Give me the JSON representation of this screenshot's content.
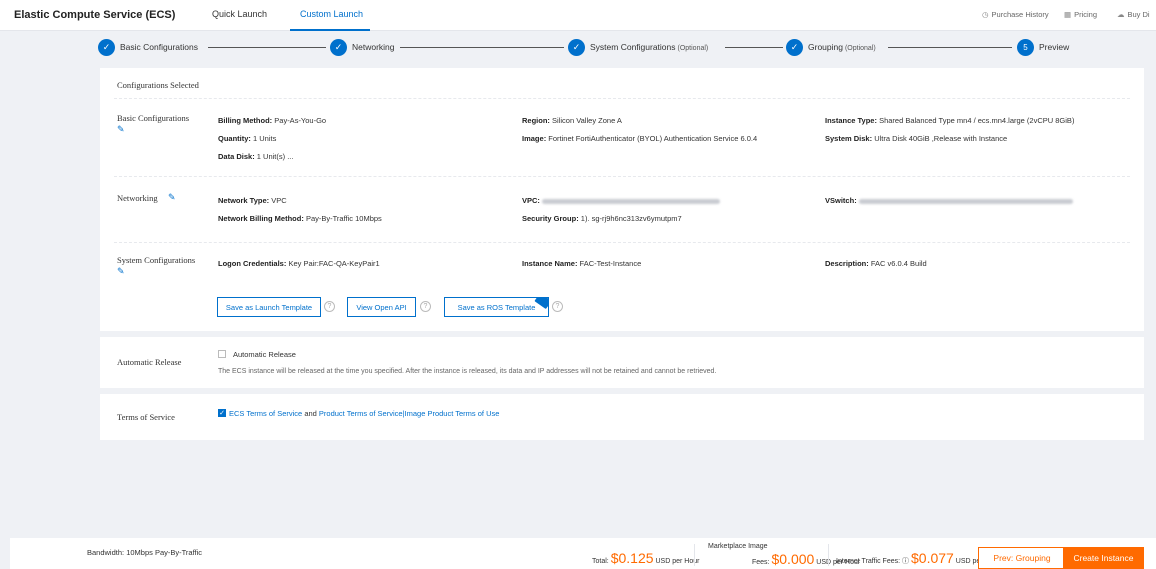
{
  "header": {
    "app_title": "Elastic Compute Service (ECS)",
    "tabs": [
      {
        "label": "Quick Launch",
        "active": false
      },
      {
        "label": "Custom Launch",
        "active": true
      }
    ],
    "links": [
      {
        "label": "Purchase History",
        "icon": "clock-icon"
      },
      {
        "label": "Pricing",
        "icon": "table-icon"
      },
      {
        "label": "Buy Di",
        "icon": "cloud-icon"
      }
    ]
  },
  "steps": [
    {
      "label": "Basic Configurations",
      "optional": "",
      "done": true
    },
    {
      "label": "Networking",
      "optional": "",
      "done": true
    },
    {
      "label": "System Configurations",
      "optional": "(Optional)",
      "done": true
    },
    {
      "label": "Grouping",
      "optional": "(Optional)",
      "done": true
    },
    {
      "label": "Preview",
      "optional": "",
      "number": "5",
      "done": false
    }
  ],
  "selected": {
    "title": "Configurations Selected",
    "basic": {
      "title": "Basic Configurations",
      "billing": {
        "key": "Billing Method",
        "value": "Pay-As-You-Go"
      },
      "quantity": {
        "key": "Quantity",
        "value": "1 Units"
      },
      "data_disk": {
        "key": "Data Disk",
        "value": "1 Unit(s) ..."
      },
      "region": {
        "key": "Region",
        "value": "Silicon Valley Zone A"
      },
      "image": {
        "key": "Image",
        "value": "Fortinet FortiAuthenticator (BYOL) Authentication Service 6.0.4"
      },
      "instance_type": {
        "key": "Instance Type",
        "value": "Shared Balanced Type mn4 / ecs.mn4.large  (2vCPU 8GiB)"
      },
      "system_disk": {
        "key": "System Disk",
        "value": "Ultra Disk 40GiB ,Release with Instance"
      }
    },
    "networking": {
      "title": "Networking",
      "network_type": {
        "key": "Network Type",
        "value": "VPC"
      },
      "billing": {
        "key": "Network Billing Method",
        "value": "Pay-By-Traffic 10Mbps"
      },
      "vpc": {
        "key": "VPC"
      },
      "security_group": {
        "key": "Security Group",
        "value": "1). sg-rj9h6nc313zv6ymutpm7"
      },
      "vswitch": {
        "key": "VSwitch"
      }
    },
    "system": {
      "title": "System Configurations",
      "logon": {
        "key": "Logon Credentials",
        "value": "Key Pair:FAC-QA-KeyPair1"
      },
      "instance_name": {
        "key": "Instance Name",
        "value": "FAC-Test-Instance"
      },
      "description": {
        "key": "Description",
        "value": "FAC v6.0.4 Build"
      }
    },
    "actions": {
      "save_launch": "Save as Launch Template",
      "view_api": "View Open API",
      "save_ros": "Save as ROS Template",
      "help_glyph": "?"
    }
  },
  "release": {
    "title": "Automatic Release",
    "checkbox_label": "Automatic Release",
    "checked": false,
    "note": "The ECS instance will be released at the time you specified. After the instance is released, its data and IP addresses will not be retained and cannot be retrieved."
  },
  "terms": {
    "title": "Terms of Service",
    "checked": true,
    "ecs_terms": "ECS Terms of Service",
    "and": "and",
    "product_terms": "Product Terms of Service",
    "sep": "|",
    "image_terms": "Image Product Terms of Use"
  },
  "footer": {
    "bandwidth": "Bandwidth: 10Mbps Pay-By-Traffic",
    "total_label": "Total:",
    "total_currency": "$",
    "total_amount": "0.125",
    "total_unit": "USD per Hour",
    "marketplace_label": "Marketplace Image",
    "marketplace_fee_label": "Fees:",
    "marketplace_currency": "$",
    "marketplace_amount": "0.000",
    "marketplace_unit": "USD per Hour",
    "traffic_label": "Internet Traffic Fees:",
    "traffic_currency": "$",
    "traffic_amount": "0.077",
    "traffic_unit": "USD per GB",
    "prev_button": "Prev: Grouping",
    "create_button": "Create Instance"
  },
  "colors": {
    "accent": "#0070cc",
    "orange": "#ff6a00",
    "background": "#eff1f5"
  }
}
